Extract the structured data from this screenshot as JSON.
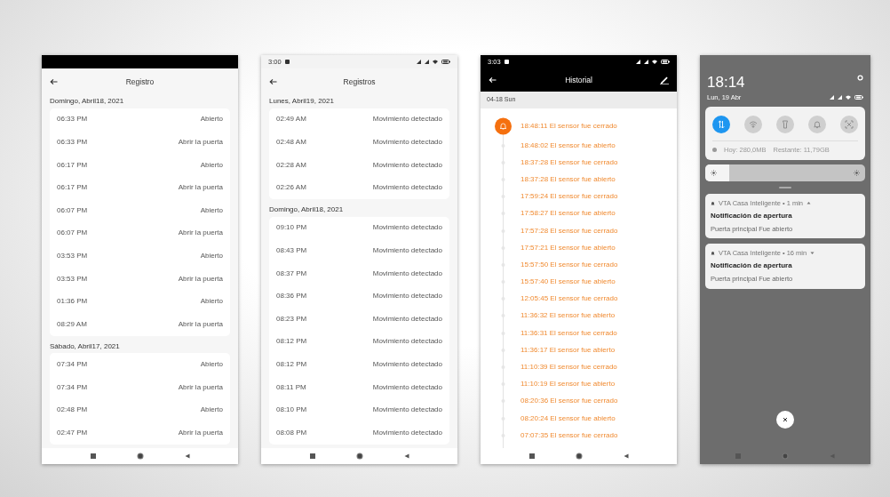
{
  "phones": [
    {
      "kind": "log",
      "status_bar": {
        "dark": true
      },
      "title": "Registro",
      "groups": [
        {
          "date": "Domingo, Abril18, 2021",
          "rows": [
            {
              "time": "06:33 PM",
              "event": "Abierto"
            },
            {
              "time": "06:33 PM",
              "event": "Abrir la puerta"
            },
            {
              "time": "06:17 PM",
              "event": "Abierto"
            },
            {
              "time": "06:17 PM",
              "event": "Abrir la puerta"
            },
            {
              "time": "06:07 PM",
              "event": "Abierto"
            },
            {
              "time": "06:07 PM",
              "event": "Abrir la puerta"
            },
            {
              "time": "03:53 PM",
              "event": "Abierto"
            },
            {
              "time": "03:53 PM",
              "event": "Abrir la puerta"
            },
            {
              "time": "01:36 PM",
              "event": "Abierto"
            },
            {
              "time": "08:29 AM",
              "event": "Abrir la puerta"
            }
          ]
        },
        {
          "date": "Sábado, Abril17, 2021",
          "rows": [
            {
              "time": "07:34 PM",
              "event": "Abierto"
            },
            {
              "time": "07:34 PM",
              "event": "Abrir la puerta"
            },
            {
              "time": "02:48 PM",
              "event": "Abierto"
            },
            {
              "time": "02:47 PM",
              "event": "Abrir la puerta"
            }
          ]
        }
      ]
    },
    {
      "kind": "log",
      "status_bar": {
        "dark": false,
        "time": "3:00"
      },
      "title": "Registros",
      "groups": [
        {
          "date": "Lunes, Abril19, 2021",
          "rows": [
            {
              "time": "02:49 AM",
              "event": "Movimiento detectado"
            },
            {
              "time": "02:48 AM",
              "event": "Movimiento detectado"
            },
            {
              "time": "02:28 AM",
              "event": "Movimiento detectado"
            },
            {
              "time": "02:26 AM",
              "event": "Movimiento detectado"
            }
          ]
        },
        {
          "date": "Domingo, Abril18, 2021",
          "rows": [
            {
              "time": "09:10 PM",
              "event": "Movimiento detectado"
            },
            {
              "time": "08:43 PM",
              "event": "Movimiento detectado"
            },
            {
              "time": "08:37 PM",
              "event": "Movimiento detectado"
            },
            {
              "time": "08:36 PM",
              "event": "Movimiento detectado"
            },
            {
              "time": "08:23 PM",
              "event": "Movimiento detectado"
            },
            {
              "time": "08:12 PM",
              "event": "Movimiento detectado"
            },
            {
              "time": "08:12 PM",
              "event": "Movimiento detectado"
            },
            {
              "time": "08:11 PM",
              "event": "Movimiento detectado"
            },
            {
              "time": "08:10 PM",
              "event": "Movimiento detectado"
            },
            {
              "time": "08:08 PM",
              "event": "Movimiento detectado"
            }
          ]
        }
      ]
    },
    {
      "kind": "timeline",
      "status_bar": {
        "dark": true,
        "time": "3:03"
      },
      "title": "Historial",
      "date": "04-18  Sun",
      "entries": [
        {
          "kind": "alert",
          "text": "18:48:11 El sensor fue cerrado"
        },
        {
          "kind": "dot",
          "text": "18:48:02 El sensor fue abierto"
        },
        {
          "kind": "dot",
          "text": "18:37:28 El sensor fue cerrado"
        },
        {
          "kind": "dot",
          "text": "18:37:28 El sensor fue abierto"
        },
        {
          "kind": "dot",
          "text": "17:59:24 El sensor fue cerrado"
        },
        {
          "kind": "dot",
          "text": "17:58:27 El sensor fue abierto"
        },
        {
          "kind": "dot",
          "text": "17:57:28 El sensor fue cerrado"
        },
        {
          "kind": "dot",
          "text": "17:57:21 El sensor fue abierto"
        },
        {
          "kind": "dot",
          "text": "15:57:50 El sensor fue cerrado"
        },
        {
          "kind": "dot",
          "text": "15:57:40 El sensor fue abierto"
        },
        {
          "kind": "dot",
          "text": "12:05:45 El sensor fue cerrado"
        },
        {
          "kind": "dot",
          "text": "11:36:32 El sensor fue abierto"
        },
        {
          "kind": "dot",
          "text": "11:36:31 El sensor fue cerrado"
        },
        {
          "kind": "dot",
          "text": "11:36:17 El sensor fue abierto"
        },
        {
          "kind": "dot",
          "text": "11:10:39 El sensor fue cerrado"
        },
        {
          "kind": "dot",
          "text": "11:10:19 El sensor fue abierto"
        },
        {
          "kind": "dot",
          "text": "08:20:36 El sensor fue cerrado"
        },
        {
          "kind": "dot",
          "text": "08:20:24 El sensor fue abierto"
        },
        {
          "kind": "dot",
          "text": "07:07:35 El sensor fue cerrado"
        }
      ]
    },
    {
      "kind": "shade",
      "clock": "18:14",
      "date": "Lun, 19 Abr",
      "toggles": [
        {
          "on": true
        },
        {
          "on": false
        },
        {
          "on": false
        },
        {
          "on": false
        },
        {
          "on": false
        }
      ],
      "data_usage": [
        "Hoy: 280,0MB",
        "Restante: 11,79GB"
      ],
      "brightness": {
        "level": 0.15
      },
      "notifications": [
        {
          "header": "VTA Casa Inteligente • 1 min",
          "expanded": true,
          "title": "Notificación de apertura",
          "body": "Puerta principal Fue abierto"
        },
        {
          "header": "VTA Casa Inteligente • 16 min",
          "expanded": false,
          "title": "Notificación de apertura",
          "body": "Puerta principal Fue abierto"
        }
      ]
    }
  ]
}
